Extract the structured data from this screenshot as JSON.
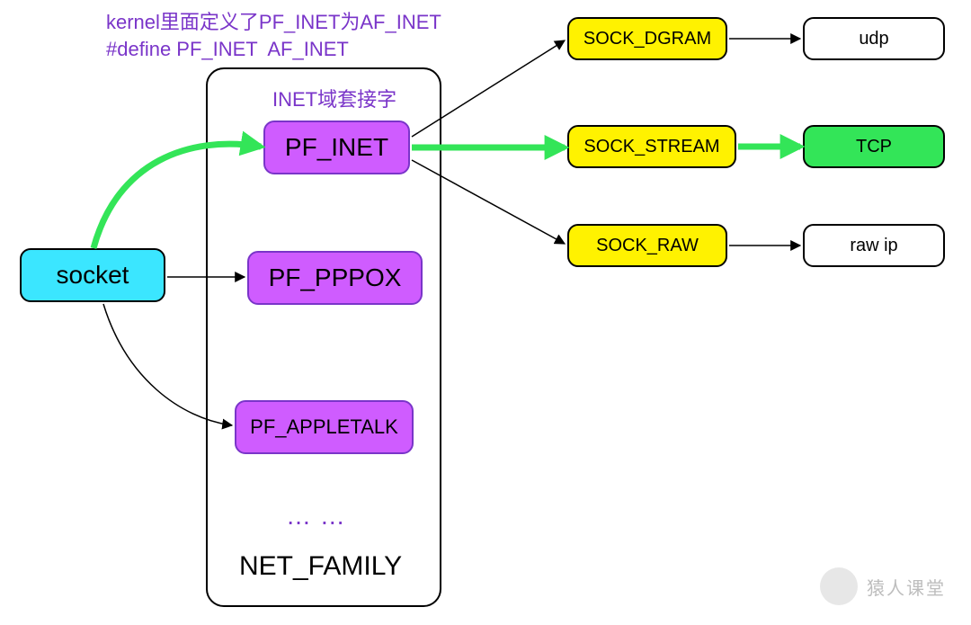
{
  "note": {
    "line1": "kernel里面定义了PF_INET为AF_INET",
    "line2": "#define PF_INET  AF_INET"
  },
  "labels": {
    "inet_title": "INET域套接字",
    "family_label": "NET_FAMILY",
    "dots": "……"
  },
  "nodes": {
    "socket": {
      "text": "socket",
      "fill": "#3be6ff",
      "stroke": "#000000"
    },
    "pf_inet": {
      "text": "PF_INET",
      "fill": "#cf5cff",
      "stroke": "#7a35c9"
    },
    "pf_pppox": {
      "text": "PF_PPPOX",
      "fill": "#cf5cff",
      "stroke": "#7a35c9"
    },
    "pf_appletalk": {
      "text": "PF_APPLETALK",
      "fill": "#cf5cff",
      "stroke": "#7a35c9"
    },
    "sock_dgram": {
      "text": "SOCK_DGRAM",
      "fill": "#fff200",
      "stroke": "#000000"
    },
    "sock_stream": {
      "text": "SOCK_STREAM",
      "fill": "#fff200",
      "stroke": "#000000"
    },
    "sock_raw": {
      "text": "SOCK_RAW",
      "fill": "#fff200",
      "stroke": "#000000"
    },
    "udp": {
      "text": "udp",
      "fill": "#ffffff",
      "stroke": "#000000"
    },
    "tcp": {
      "text": "TCP",
      "fill": "#33e558",
      "stroke": "#000000"
    },
    "rawip": {
      "text": "raw ip",
      "fill": "#ffffff",
      "stroke": "#000000"
    }
  },
  "edges": [
    {
      "from": "socket",
      "to": "pf_inet",
      "color": "#33e558",
      "width": 6
    },
    {
      "from": "socket",
      "to": "pf_pppox",
      "color": "#000000",
      "width": 1
    },
    {
      "from": "socket",
      "to": "pf_appletalk",
      "color": "#000000",
      "width": 1
    },
    {
      "from": "pf_inet",
      "to": "sock_dgram",
      "color": "#000000",
      "width": 1
    },
    {
      "from": "pf_inet",
      "to": "sock_stream",
      "color": "#33e558",
      "width": 6
    },
    {
      "from": "pf_inet",
      "to": "sock_raw",
      "color": "#000000",
      "width": 1
    },
    {
      "from": "sock_dgram",
      "to": "udp",
      "color": "#000000",
      "width": 1
    },
    {
      "from": "sock_stream",
      "to": "tcp",
      "color": "#33e558",
      "width": 6
    },
    {
      "from": "sock_raw",
      "to": "rawip",
      "color": "#000000",
      "width": 1
    }
  ],
  "watermark": {
    "text": "猿人课堂"
  }
}
